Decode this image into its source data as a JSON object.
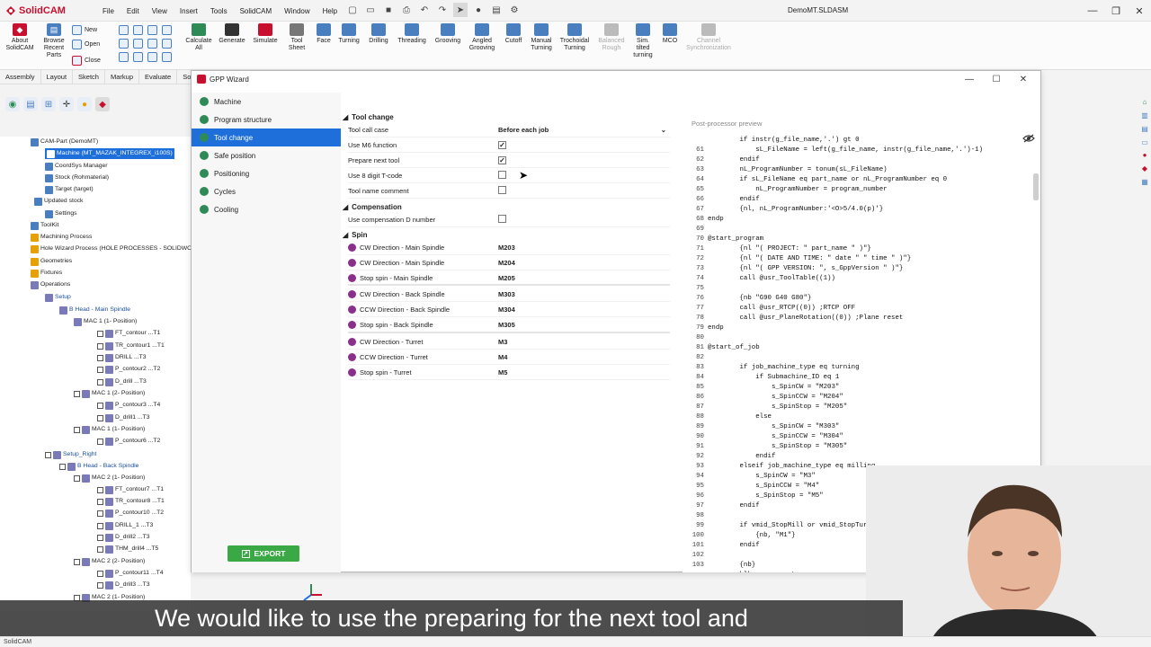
{
  "app": {
    "name": "SolidCAM",
    "document_title": "DemoMT.SLDASM",
    "status": "SolidCAM"
  },
  "menu": [
    "File",
    "Edit",
    "View",
    "Insert",
    "Tools",
    "SolidCAM",
    "Window",
    "Help"
  ],
  "ribbon": {
    "about": "About SolidCAM",
    "browse": "Browse Recent Parts",
    "new": "New",
    "open": "Open",
    "close": "Close",
    "tools": [
      {
        "label": "Calculate All",
        "icon": "calculate-icon",
        "color": "#2e8b57"
      },
      {
        "label": "Generate",
        "icon": "generate-icon",
        "color": "#333333"
      },
      {
        "label": "Simulate",
        "icon": "simulate-icon",
        "color": "#c8102e"
      },
      {
        "label": "Tool Sheet",
        "icon": "tool-sheet-icon",
        "color": "#777777"
      },
      {
        "label": "Face",
        "icon": "face-icon",
        "color": "#4a7fbf"
      },
      {
        "label": "Turning",
        "icon": "turning-icon",
        "color": "#4a7fbf"
      },
      {
        "label": "Drilling",
        "icon": "drilling-icon",
        "color": "#4a7fbf"
      },
      {
        "label": "Threading",
        "icon": "threading-icon",
        "color": "#4a7fbf"
      },
      {
        "label": "Grooving",
        "icon": "grooving-icon",
        "color": "#4a7fbf"
      },
      {
        "label": "Angled Grooving",
        "icon": "angled-grooving-icon",
        "color": "#4a7fbf"
      },
      {
        "label": "Cutoff",
        "icon": "cutoff-icon",
        "color": "#4a7fbf"
      },
      {
        "label": "Manual Turning",
        "icon": "manual-turning-icon",
        "color": "#4a7fbf"
      },
      {
        "label": "Trochoidal Turning",
        "icon": "trochoidal-icon",
        "color": "#4a7fbf"
      },
      {
        "label": "Balanced Rough",
        "icon": "balanced-rough-icon",
        "color": "#bbbbbb"
      },
      {
        "label": "Sim. tilted turning",
        "icon": "sim-tilted-icon",
        "color": "#4a7fbf"
      },
      {
        "label": "MCO",
        "icon": "mco-icon",
        "color": "#4a7fbf"
      },
      {
        "label": "Channel Synchronization",
        "icon": "channel-sync-icon",
        "color": "#bbbbbb"
      }
    ]
  },
  "tabs": [
    "Assembly",
    "Layout",
    "Sketch",
    "Markup",
    "Evaluate",
    "So"
  ],
  "tree": [
    {
      "t": "CAM-Part (DemoMT)"
    },
    {
      "t": "Machine (MT_MAZAK_INTEGREX_i100S)"
    },
    {
      "t": "CoordSys Manager"
    },
    {
      "t": "Stock (Rohmaterial)"
    },
    {
      "t": "Target (target)"
    },
    {
      "t": "Updated stock"
    },
    {
      "t": "Settings"
    },
    {
      "t": "ToolKit"
    },
    {
      "t": "Machining Process"
    },
    {
      "t": "Hole Wizard Process (HOLE PROCESSES - SOLIDWORKS)"
    },
    {
      "t": "Geometries"
    },
    {
      "t": "Fixtures"
    },
    {
      "t": "Operations"
    },
    {
      "t": "Setup"
    },
    {
      "t": "B Head - Main Spindle"
    },
    {
      "t": "MAC 1 (1- Position)"
    },
    {
      "t": "FT_contour ...T1"
    },
    {
      "t": "TR_contour1 ...T1"
    },
    {
      "t": "DRILL ...T3"
    },
    {
      "t": "P_contour2 ...T2"
    },
    {
      "t": "D_drill ...T3"
    },
    {
      "t": "MAC 1 (2- Position)"
    },
    {
      "t": "P_contour3 ...T4"
    },
    {
      "t": "D_drill1 ...T3"
    },
    {
      "t": "MAC 1 (1- Position)"
    },
    {
      "t": "P_contour6 ...T2"
    },
    {
      "t": "Setup_Right"
    },
    {
      "t": "B Head - Back Spindle"
    },
    {
      "t": "MAC 2 (1- Position)"
    },
    {
      "t": "FT_contour7 ...T1"
    },
    {
      "t": "TR_contour8 ...T1"
    },
    {
      "t": "P_contour10 ...T2"
    },
    {
      "t": "DRILL_1 ...T3"
    },
    {
      "t": "D_drill2 ...T3"
    },
    {
      "t": "THM_drill4 ...T5"
    },
    {
      "t": "MAC 2 (2- Position)"
    },
    {
      "t": "P_contour11 ...T4"
    },
    {
      "t": "D_drill3 ...T3"
    },
    {
      "t": "MAC 2 (1- Position)"
    }
  ],
  "gpp": {
    "title": "GPP Wizard",
    "nav": [
      {
        "label": "Machine",
        "color": "#2e8b57"
      },
      {
        "label": "Program structure",
        "color": "#2e8b57"
      },
      {
        "label": "Tool change",
        "color": "#2e8b57"
      },
      {
        "label": "Safe position",
        "color": "#2e8b57"
      },
      {
        "label": "Positioning",
        "color": "#2e8b57"
      },
      {
        "label": "Cycles",
        "color": "#2e8b57"
      },
      {
        "label": "Cooling",
        "color": "#2e8b57"
      }
    ],
    "export": "EXPORT",
    "sections": {
      "tool_change": "Tool change",
      "compensation": "Compensation",
      "spin": "Spin"
    },
    "tool_change": [
      {
        "label": "Tool call case",
        "value": "Before each job",
        "kind": "select"
      },
      {
        "label": "Use M6 function",
        "checked": true,
        "kind": "check"
      },
      {
        "label": "Prepare next tool",
        "checked": true,
        "kind": "check"
      },
      {
        "label": "Use 8 digit T-code",
        "checked": false,
        "kind": "check"
      },
      {
        "label": "Tool name comment",
        "checked": false,
        "kind": "check"
      }
    ],
    "compensation": [
      {
        "label": "Use compensation D number",
        "checked": false
      }
    ],
    "spin": [
      {
        "label": "CW Direction - Main Spindle",
        "value": "M203"
      },
      {
        "label": "CW Direction - Main Spindle",
        "value": "M204"
      },
      {
        "label": "Stop spin - Main Spindle",
        "value": "M205"
      },
      {
        "label": "CW Direction - Back Spindle",
        "value": "M303"
      },
      {
        "label": "CCW Direction - Back Spindle",
        "value": "M304"
      },
      {
        "label": "Stop spin - Back Spindle",
        "value": "M305"
      },
      {
        "label": "CW Direction - Turret",
        "value": "M3"
      },
      {
        "label": "CCW Direction - Turret",
        "value": "M4"
      },
      {
        "label": "Stop spin - Turret",
        "value": "M5"
      }
    ],
    "preview_title": "Post-processor preview",
    "code": [
      {
        "n": "",
        "c": "        if instr(g_file_name,'.') gt 0"
      },
      {
        "n": "61",
        "c": "            sL_FileName = left(g_file_name, instr(g_file_name,'.')-1)"
      },
      {
        "n": "62",
        "c": "        endif"
      },
      {
        "n": "63",
        "c": "        nL_ProgramNumber = tonum(sL_FileName)"
      },
      {
        "n": "64",
        "c": "        if sL_FileName eq part_name or nL_ProgramNumber eq 0"
      },
      {
        "n": "65",
        "c": "            nL_ProgramNumber = program_number"
      },
      {
        "n": "66",
        "c": "        endif"
      },
      {
        "n": "67",
        "c": "        {nl, nL_ProgramNumber:'<O>5/4.0(p)'}"
      },
      {
        "n": "68",
        "c": "endp"
      },
      {
        "n": "69",
        "c": ""
      },
      {
        "n": "70",
        "c": "@start_program"
      },
      {
        "n": "71",
        "c": "        {nl \"( PROJECT: \" part_name \" )\"}"
      },
      {
        "n": "72",
        "c": "        {nl \"( DATE AND TIME: \" date \" \" time \" )\"}"
      },
      {
        "n": "73",
        "c": "        {nl \"( GPP VERSION: \", s_GppVersion \" )\"}"
      },
      {
        "n": "74",
        "c": "        call @usr_ToolTable((1))"
      },
      {
        "n": "75",
        "c": ""
      },
      {
        "n": "76",
        "c": "        {nb \"G90 G40 G80\"}"
      },
      {
        "n": "77",
        "c": "        call @usr_RTCP((0)) ;RTCP OFF"
      },
      {
        "n": "78",
        "c": "        call @usr_PlaneRotation((0)) ;Plane reset"
      },
      {
        "n": "79",
        "c": "endp"
      },
      {
        "n": "80",
        "c": ""
      },
      {
        "n": "81",
        "c": "@start_of_job"
      },
      {
        "n": "82",
        "c": ""
      },
      {
        "n": "83",
        "c": "        if job_machine_type eq turning"
      },
      {
        "n": "84",
        "c": "            if Submachine_ID eq 1"
      },
      {
        "n": "85",
        "c": "                s_SpinCW = \"M203\""
      },
      {
        "n": "86",
        "c": "                s_SpinCCW = \"M204\""
      },
      {
        "n": "87",
        "c": "                s_SpinStop = \"M205\""
      },
      {
        "n": "88",
        "c": "            else"
      },
      {
        "n": "89",
        "c": "                s_SpinCW = \"M303\""
      },
      {
        "n": "90",
        "c": "                s_SpinCCW = \"M304\""
      },
      {
        "n": "91",
        "c": "                s_SpinStop = \"M305\""
      },
      {
        "n": "92",
        "c": "            endif"
      },
      {
        "n": "93",
        "c": "        elseif job_machine_type eq milling"
      },
      {
        "n": "94",
        "c": "            s_SpinCW = \"M3\""
      },
      {
        "n": "95",
        "c": "            s_SpinCCW = \"M4\""
      },
      {
        "n": "96",
        "c": "            s_SpinStop = \"M5\""
      },
      {
        "n": "97",
        "c": "        endif"
      },
      {
        "n": "98",
        "c": ""
      },
      {
        "n": "99",
        "c": "        if vmid_StopMill or vmid_StopTur"
      },
      {
        "n": "100",
        "c": "            {nb, \"M1\"}"
      },
      {
        "n": "101",
        "c": "        endif"
      },
      {
        "n": "102",
        "c": ""
      },
      {
        "n": "103",
        "c": "        {nb}"
      },
      {
        "n": "",
        "c": "        blknum_gen = true"
      }
    ]
  },
  "caption": "We would like to use the preparing for the next tool and",
  "colors": {
    "accent": "#1e6fd9",
    "export": "#3aa845",
    "brand": "#c8102e"
  }
}
